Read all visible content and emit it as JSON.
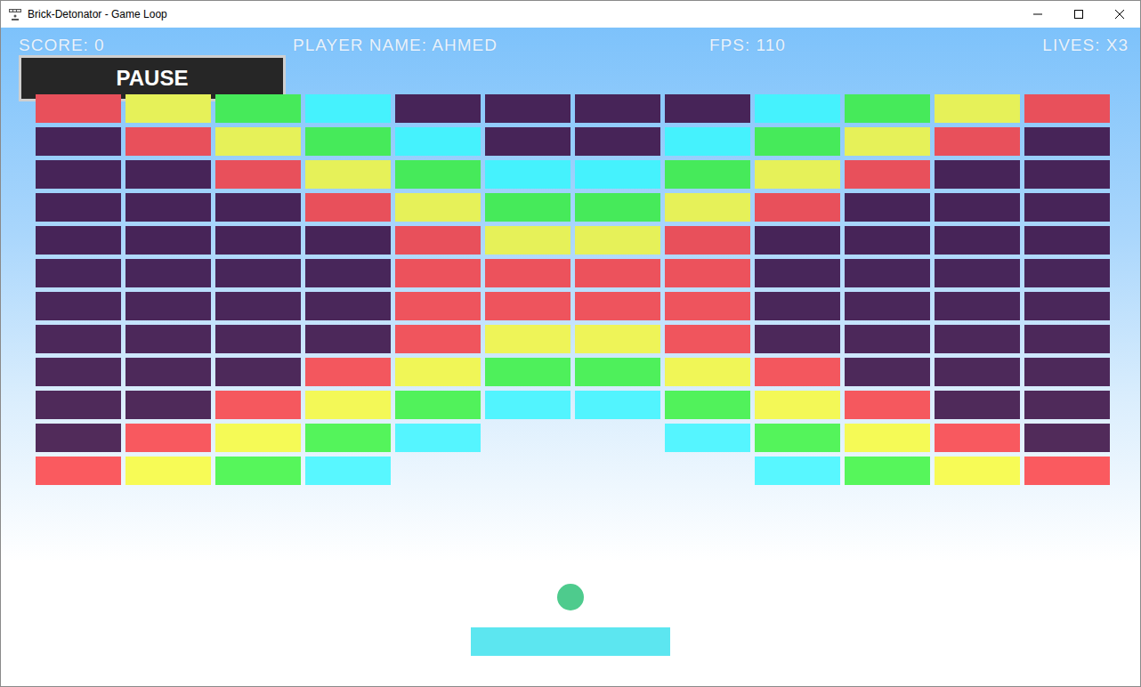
{
  "window": {
    "title": "Brick-Detonator - Game Loop"
  },
  "hud": {
    "score": "SCORE: 0",
    "player": "PLAYER NAME: AHMED",
    "fps": "FPS: 110",
    "lives": "LIVES: X3",
    "pause_button": "PAUSE"
  },
  "bricks": [
    [
      {
        "color": "#e8505b",
        "broken": false
      },
      {
        "color": "#e6f159",
        "broken": false
      },
      {
        "color": "#46ea5a",
        "broken": false
      },
      {
        "color": "#45f2fd",
        "broken": false
      },
      {
        "color": "#472458",
        "broken": false
      },
      {
        "color": "#472458",
        "broken": false
      },
      {
        "color": "#472458",
        "broken": false
      },
      {
        "color": "#472458",
        "broken": false
      },
      {
        "color": "#45f2fd",
        "broken": false
      },
      {
        "color": "#46ea5a",
        "broken": false
      },
      {
        "color": "#e6f159",
        "broken": false
      },
      {
        "color": "#e8505b",
        "broken": false
      }
    ],
    [
      {
        "color": "#472458",
        "broken": false
      },
      {
        "color": "#e8505b",
        "broken": false
      },
      {
        "color": "#e6f159",
        "broken": false
      },
      {
        "color": "#46ea5a",
        "broken": false
      },
      {
        "color": "#45f2fd",
        "broken": false
      },
      {
        "color": "#472458",
        "broken": false
      },
      {
        "color": "#472458",
        "broken": false
      },
      {
        "color": "#45f2fd",
        "broken": false
      },
      {
        "color": "#46ea5a",
        "broken": false
      },
      {
        "color": "#e6f159",
        "broken": false
      },
      {
        "color": "#e8505b",
        "broken": false
      },
      {
        "color": "#472458",
        "broken": false
      }
    ],
    [
      {
        "color": "#472458",
        "broken": false
      },
      {
        "color": "#472458",
        "broken": false
      },
      {
        "color": "#e8505b",
        "broken": false
      },
      {
        "color": "#e6f159",
        "broken": false
      },
      {
        "color": "#46ea5a",
        "broken": false
      },
      {
        "color": "#45f2fd",
        "broken": false
      },
      {
        "color": "#45f2fd",
        "broken": false
      },
      {
        "color": "#46ea5a",
        "broken": false
      },
      {
        "color": "#e6f159",
        "broken": false
      },
      {
        "color": "#e8505b",
        "broken": false
      },
      {
        "color": "#472458",
        "broken": false
      },
      {
        "color": "#472458",
        "broken": false
      }
    ],
    [
      {
        "color": "#472458",
        "broken": false
      },
      {
        "color": "#472458",
        "broken": false
      },
      {
        "color": "#472458",
        "broken": false
      },
      {
        "color": "#e8505b",
        "broken": false
      },
      {
        "color": "#e6f159",
        "broken": false
      },
      {
        "color": "#46ea5a",
        "broken": false
      },
      {
        "color": "#46ea5a",
        "broken": false
      },
      {
        "color": "#e6f159",
        "broken": false
      },
      {
        "color": "#e8505b",
        "broken": false
      },
      {
        "color": "#472458",
        "broken": false
      },
      {
        "color": "#472458",
        "broken": false
      },
      {
        "color": "#472458",
        "broken": false
      }
    ],
    [
      {
        "color": "#472458",
        "broken": false
      },
      {
        "color": "#472458",
        "broken": false
      },
      {
        "color": "#472458",
        "broken": false
      },
      {
        "color": "#472458",
        "broken": false
      },
      {
        "color": "#e8505b",
        "broken": false
      },
      {
        "color": "#e6f159",
        "broken": false
      },
      {
        "color": "#e6f159",
        "broken": false
      },
      {
        "color": "#e8505b",
        "broken": false
      },
      {
        "color": "#472458",
        "broken": false
      },
      {
        "color": "#472458",
        "broken": false
      },
      {
        "color": "#472458",
        "broken": false
      },
      {
        "color": "#472458",
        "broken": false
      }
    ],
    [
      {
        "color": "#48265a",
        "broken": false
      },
      {
        "color": "#48265a",
        "broken": false
      },
      {
        "color": "#48265a",
        "broken": false
      },
      {
        "color": "#48265a",
        "broken": false
      },
      {
        "color": "#ec525c",
        "broken": false
      },
      {
        "color": "#ec525c",
        "broken": false
      },
      {
        "color": "#ec525c",
        "broken": false
      },
      {
        "color": "#ec525c",
        "broken": false
      },
      {
        "color": "#48265a",
        "broken": false
      },
      {
        "color": "#48265a",
        "broken": false
      },
      {
        "color": "#48265a",
        "broken": false
      },
      {
        "color": "#48265a",
        "broken": false
      }
    ],
    [
      {
        "color": "#4a275a",
        "broken": false
      },
      {
        "color": "#4a275a",
        "broken": false
      },
      {
        "color": "#4a275a",
        "broken": false
      },
      {
        "color": "#4a275a",
        "broken": false
      },
      {
        "color": "#ee545d",
        "broken": false
      },
      {
        "color": "#ee545d",
        "broken": false
      },
      {
        "color": "#ee545d",
        "broken": false
      },
      {
        "color": "#ee545d",
        "broken": false
      },
      {
        "color": "#4a275a",
        "broken": false
      },
      {
        "color": "#4a275a",
        "broken": false
      },
      {
        "color": "#4a275a",
        "broken": false
      },
      {
        "color": "#4a275a",
        "broken": false
      }
    ],
    [
      {
        "color": "#4c285a",
        "broken": false
      },
      {
        "color": "#4c285a",
        "broken": false
      },
      {
        "color": "#4c285a",
        "broken": false
      },
      {
        "color": "#4c285a",
        "broken": false
      },
      {
        "color": "#f0555d",
        "broken": false
      },
      {
        "color": "#eef458",
        "broken": false
      },
      {
        "color": "#eef458",
        "broken": false
      },
      {
        "color": "#f0555d",
        "broken": false
      },
      {
        "color": "#4c285a",
        "broken": false
      },
      {
        "color": "#4c285a",
        "broken": false
      },
      {
        "color": "#4c285a",
        "broken": false
      },
      {
        "color": "#4c285a",
        "broken": false
      }
    ],
    [
      {
        "color": "#4d295a",
        "broken": false
      },
      {
        "color": "#4d295a",
        "broken": false
      },
      {
        "color": "#4d295a",
        "broken": false
      },
      {
        "color": "#f3575e",
        "broken": false
      },
      {
        "color": "#f0f657",
        "broken": false
      },
      {
        "color": "#4ef05b",
        "broken": false
      },
      {
        "color": "#4ef05b",
        "broken": false
      },
      {
        "color": "#f0f657",
        "broken": false
      },
      {
        "color": "#f3575e",
        "broken": false
      },
      {
        "color": "#4d295a",
        "broken": false
      },
      {
        "color": "#4d295a",
        "broken": false
      },
      {
        "color": "#4d295a",
        "broken": false
      }
    ],
    [
      {
        "color": "#4f2a5a",
        "broken": false
      },
      {
        "color": "#4f2a5a",
        "broken": false
      },
      {
        "color": "#f5585e",
        "broken": false
      },
      {
        "color": "#f3f857",
        "broken": false
      },
      {
        "color": "#51f25b",
        "broken": false
      },
      {
        "color": "#52f4fe",
        "broken": false
      },
      {
        "color": "#52f4fe",
        "broken": false
      },
      {
        "color": "#51f25b",
        "broken": false
      },
      {
        "color": "#f3f857",
        "broken": false
      },
      {
        "color": "#f5585e",
        "broken": false
      },
      {
        "color": "#4f2a5a",
        "broken": false
      },
      {
        "color": "#4f2a5a",
        "broken": false
      }
    ],
    [
      {
        "color": "#512b5a",
        "broken": false
      },
      {
        "color": "#f8595f",
        "broken": false
      },
      {
        "color": "#f5fa56",
        "broken": false
      },
      {
        "color": "#54f45b",
        "broken": false
      },
      {
        "color": "#55f5ff",
        "broken": false
      },
      {
        "broken": true
      },
      {
        "broken": true
      },
      {
        "color": "#55f5ff",
        "broken": false
      },
      {
        "color": "#54f45b",
        "broken": false
      },
      {
        "color": "#f5fa56",
        "broken": false
      },
      {
        "color": "#f8595f",
        "broken": false
      },
      {
        "color": "#512b5a",
        "broken": false
      }
    ],
    [
      {
        "color": "#fa5a5f",
        "broken": false
      },
      {
        "color": "#f7fb56",
        "broken": false
      },
      {
        "color": "#56f65b",
        "broken": false
      },
      {
        "color": "#58f7ff",
        "broken": false
      },
      {
        "broken": true
      },
      {
        "broken": true
      },
      {
        "broken": true
      },
      {
        "broken": true
      },
      {
        "color": "#58f7ff",
        "broken": false
      },
      {
        "color": "#56f65b",
        "broken": false
      },
      {
        "color": "#f7fb56",
        "broken": false
      },
      {
        "color": "#fa5a5f",
        "broken": false
      }
    ]
  ]
}
